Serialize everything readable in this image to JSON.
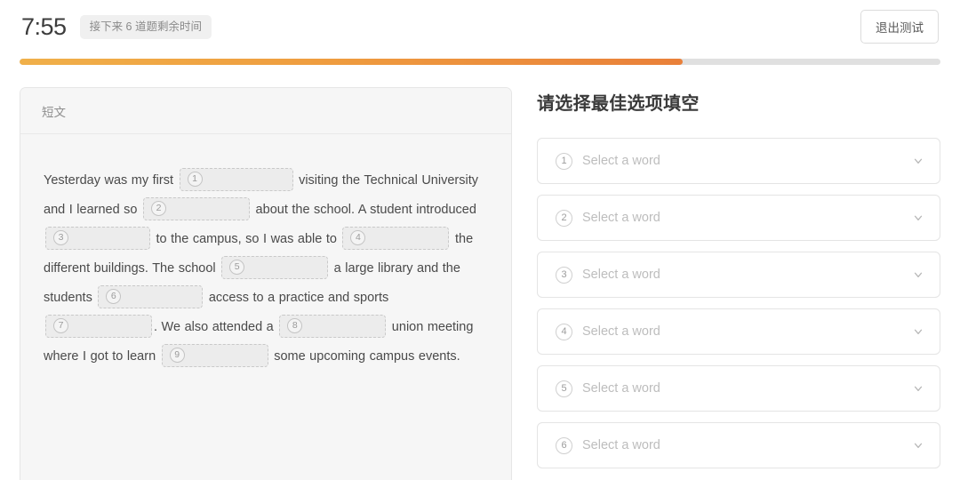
{
  "header": {
    "timer": "7:55",
    "timer_badge": "接下来 6 道题剩余时间",
    "exit_label": "退出测试"
  },
  "progress": {
    "percent": 72,
    "fill_start_color": "#f0b04a",
    "fill_end_color": "#e9803a",
    "track_color": "#e0e0e0"
  },
  "passage": {
    "panel_title": "短文",
    "segments": [
      {
        "type": "text",
        "value": "Yesterday was my first "
      },
      {
        "type": "blank",
        "number": "1",
        "width": 128
      },
      {
        "type": "text",
        "value": " visiting the Technical University and I learned so "
      },
      {
        "type": "blank",
        "number": "2",
        "width": 120
      },
      {
        "type": "text",
        "value": " about the school. A student introduced "
      },
      {
        "type": "blank",
        "number": "3",
        "width": 118
      },
      {
        "type": "text",
        "value": " to the campus, so I was able to "
      },
      {
        "type": "blank",
        "number": "4",
        "width": 120
      },
      {
        "type": "text",
        "value": " the different buildings. The school "
      },
      {
        "type": "blank",
        "number": "5",
        "width": 120
      },
      {
        "type": "text",
        "value": " a large library and the students "
      },
      {
        "type": "blank",
        "number": "6",
        "width": 118
      },
      {
        "type": "text",
        "value": " access to a practice and sports "
      },
      {
        "type": "blank",
        "number": "7",
        "width": 120
      },
      {
        "type": "text",
        "value": ". We also attended a "
      },
      {
        "type": "blank",
        "number": "8",
        "width": 120
      },
      {
        "type": "text",
        "value": " union meeting where I got to learn "
      },
      {
        "type": "blank",
        "number": "9",
        "width": 120
      },
      {
        "type": "text",
        "value": " some upcoming campus events."
      }
    ]
  },
  "answers": {
    "title": "请选择最佳选项填空",
    "items": [
      {
        "number": "1",
        "value": "",
        "placeholder": "Select a word"
      },
      {
        "number": "2",
        "value": "",
        "placeholder": "Select a word"
      },
      {
        "number": "3",
        "value": "",
        "placeholder": "Select a word"
      },
      {
        "number": "4",
        "value": "",
        "placeholder": "Select a word"
      },
      {
        "number": "5",
        "value": "",
        "placeholder": "Select a word"
      },
      {
        "number": "6",
        "value": "",
        "placeholder": "Select a word"
      }
    ]
  }
}
